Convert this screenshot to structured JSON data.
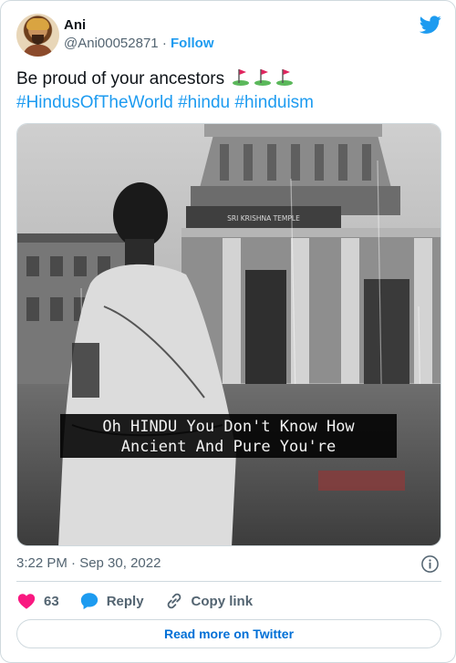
{
  "author": {
    "name": "Ani",
    "handle": "@Ani00052871",
    "separator": "·",
    "follow_label": "Follow"
  },
  "tweet": {
    "text": "Be proud of your ancestors",
    "flag_emoji_count": 3,
    "hashtags": [
      "#HindusOfTheWorld",
      "#hindu",
      "#hinduism"
    ]
  },
  "media": {
    "caption_line1": "Oh HINDU You Don't Know How",
    "caption_line2": "Ancient And Pure You're",
    "temple_sign": "SRI KRISHNA TEMPLE"
  },
  "meta": {
    "timestamp": "3:22 PM · Sep 30, 2022"
  },
  "actions": {
    "like_count": "63",
    "reply_label": "Reply",
    "copy_link_label": "Copy link"
  },
  "footer": {
    "read_more_label": "Read more on Twitter"
  },
  "colors": {
    "twitter_blue": "#1d9bf0",
    "like_pink": "#f91880",
    "text_secondary": "#536471",
    "border": "#cfd9de"
  }
}
